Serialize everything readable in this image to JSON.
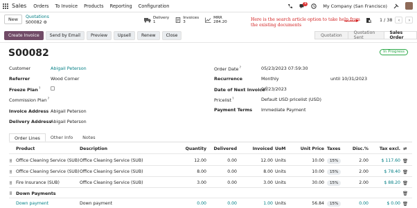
{
  "nav": {
    "app": "Sales",
    "menu": [
      "Orders",
      "To Invoice",
      "Products",
      "Reporting",
      "Configuration"
    ],
    "chat_badge": "6",
    "company": "My Company (San Francisco)"
  },
  "breadcrumb": {
    "new_label": "New",
    "parent": "Quotations",
    "current": "S00082"
  },
  "stats": [
    {
      "label": "Delivery",
      "value": "1"
    },
    {
      "label": "Invoices",
      "value": "3"
    },
    {
      "label": "MRR",
      "value": "284.20"
    }
  ],
  "annotation": "Here is the search article option to take help from the existing documents",
  "pager": {
    "text": "1 / 38"
  },
  "actions": [
    "Create Invoice",
    "Send by Email",
    "Preview",
    "Upsell",
    "Renew",
    "Close"
  ],
  "stages": [
    "Quotation",
    "Quotation Sent",
    "Sales Order"
  ],
  "record": {
    "name": "S00082",
    "status": "In Progress",
    "customer_label": "Customer",
    "customer": "Abigail Peterson",
    "referrer_label": "Referrer",
    "referrer": "Wood Corner",
    "freeze_label": "Freeze Plan",
    "commission_label": "Commission Plan",
    "invoice_addr_label": "Invoice Address",
    "invoice_addr": "Abigail Peterson",
    "delivery_addr_label": "Delivery Address",
    "delivery_addr": "Abigail Peterson",
    "order_date_label": "Order Date",
    "order_date": "05/23/2023 07:59:30",
    "recurrence_label": "Recurrence",
    "recurrence": "Monthly",
    "recurrence_until": "until 10/31/2023",
    "next_invoice_label": "Date of Next Invoice",
    "next_invoice": "06/23/2023",
    "pricelist_label": "Pricelist",
    "pricelist": "Default USD pricelist (USD)",
    "payment_terms_label": "Payment Terms",
    "payment_terms": "Immediate Payment"
  },
  "tabs": [
    "Order Lines",
    "Other Info",
    "Notes"
  ],
  "table": {
    "headers": [
      "Product",
      "Description",
      "Quantity",
      "Delivered",
      "Invoiced",
      "UoM",
      "Unit Price",
      "Taxes",
      "Disc.%",
      "Tax excl."
    ],
    "rows": [
      {
        "product": "Office Cleaning Service (SUB)",
        "description": "Office Cleaning Service (SUB)",
        "quantity": "12.00",
        "delivered": "0.00",
        "invoiced": "12.00",
        "uom": "Units",
        "price": "10.00",
        "tax": "15%",
        "disc": "2.00",
        "total": "$ 117.60"
      },
      {
        "product": "Office Cleaning Service (SUB)",
        "description": "Office Cleaning Service (SUB)",
        "quantity": "8.00",
        "delivered": "0.00",
        "invoiced": "8.00",
        "uom": "Units",
        "price": "10.00",
        "tax": "15%",
        "disc": "2.00",
        "total": "$ 78.40"
      },
      {
        "product": "Fire Insurance (SUB)",
        "description": "Office Cleaning Service (SUB)",
        "quantity": "3.00",
        "delivered": "0.00",
        "invoiced": "3.00",
        "uom": "Units",
        "price": "30.00",
        "tax": "15%",
        "disc": "2.00",
        "total": "$ 88.20"
      }
    ],
    "section": "Down Payments",
    "down": {
      "product": "Down payment",
      "description": "Down payment",
      "quantity": "0.00",
      "delivered": "0.00",
      "invoiced": "1.00",
      "uom": "Units",
      "price": "56.84",
      "tax": "15%",
      "disc": "0.00",
      "total": "$ 0.00"
    }
  },
  "colors": {
    "brand": "#714b67",
    "link": "#017e84",
    "annotation": "#d21f1f",
    "status": "#28a745"
  }
}
